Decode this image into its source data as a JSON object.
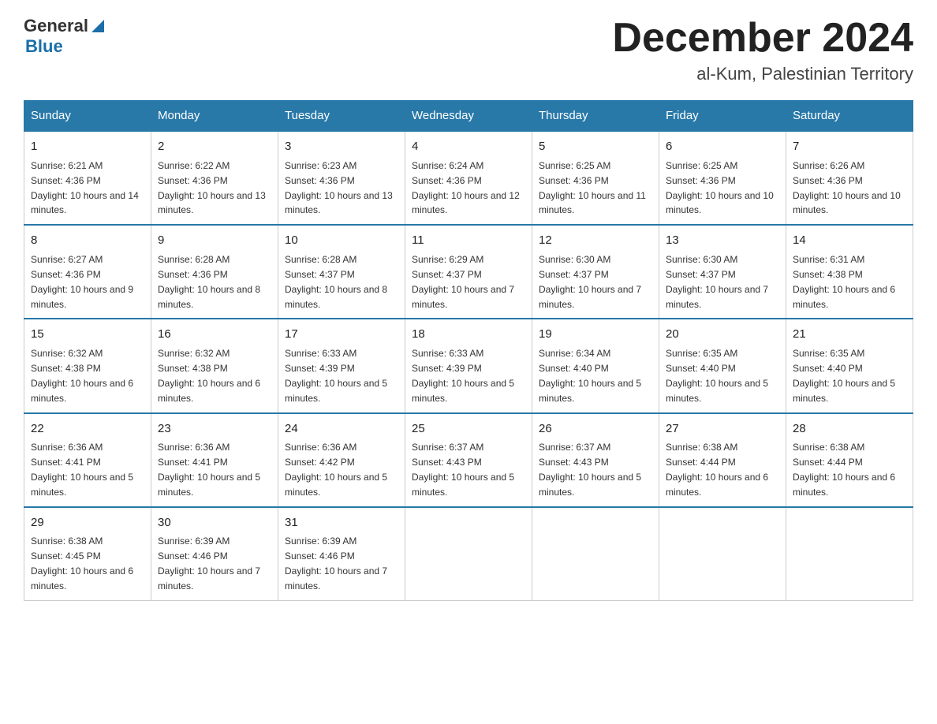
{
  "header": {
    "logo": {
      "text_general": "General",
      "text_blue": "Blue",
      "icon": "▶"
    },
    "title": "December 2024",
    "subtitle": "al-Kum, Palestinian Territory"
  },
  "calendar": {
    "days_of_week": [
      "Sunday",
      "Monday",
      "Tuesday",
      "Wednesday",
      "Thursday",
      "Friday",
      "Saturday"
    ],
    "weeks": [
      [
        {
          "day": "1",
          "sunrise": "6:21 AM",
          "sunset": "4:36 PM",
          "daylight": "10 hours and 14 minutes."
        },
        {
          "day": "2",
          "sunrise": "6:22 AM",
          "sunset": "4:36 PM",
          "daylight": "10 hours and 13 minutes."
        },
        {
          "day": "3",
          "sunrise": "6:23 AM",
          "sunset": "4:36 PM",
          "daylight": "10 hours and 13 minutes."
        },
        {
          "day": "4",
          "sunrise": "6:24 AM",
          "sunset": "4:36 PM",
          "daylight": "10 hours and 12 minutes."
        },
        {
          "day": "5",
          "sunrise": "6:25 AM",
          "sunset": "4:36 PM",
          "daylight": "10 hours and 11 minutes."
        },
        {
          "day": "6",
          "sunrise": "6:25 AM",
          "sunset": "4:36 PM",
          "daylight": "10 hours and 10 minutes."
        },
        {
          "day": "7",
          "sunrise": "6:26 AM",
          "sunset": "4:36 PM",
          "daylight": "10 hours and 10 minutes."
        }
      ],
      [
        {
          "day": "8",
          "sunrise": "6:27 AM",
          "sunset": "4:36 PM",
          "daylight": "10 hours and 9 minutes."
        },
        {
          "day": "9",
          "sunrise": "6:28 AM",
          "sunset": "4:36 PM",
          "daylight": "10 hours and 8 minutes."
        },
        {
          "day": "10",
          "sunrise": "6:28 AM",
          "sunset": "4:37 PM",
          "daylight": "10 hours and 8 minutes."
        },
        {
          "day": "11",
          "sunrise": "6:29 AM",
          "sunset": "4:37 PM",
          "daylight": "10 hours and 7 minutes."
        },
        {
          "day": "12",
          "sunrise": "6:30 AM",
          "sunset": "4:37 PM",
          "daylight": "10 hours and 7 minutes."
        },
        {
          "day": "13",
          "sunrise": "6:30 AM",
          "sunset": "4:37 PM",
          "daylight": "10 hours and 7 minutes."
        },
        {
          "day": "14",
          "sunrise": "6:31 AM",
          "sunset": "4:38 PM",
          "daylight": "10 hours and 6 minutes."
        }
      ],
      [
        {
          "day": "15",
          "sunrise": "6:32 AM",
          "sunset": "4:38 PM",
          "daylight": "10 hours and 6 minutes."
        },
        {
          "day": "16",
          "sunrise": "6:32 AM",
          "sunset": "4:38 PM",
          "daylight": "10 hours and 6 minutes."
        },
        {
          "day": "17",
          "sunrise": "6:33 AM",
          "sunset": "4:39 PM",
          "daylight": "10 hours and 5 minutes."
        },
        {
          "day": "18",
          "sunrise": "6:33 AM",
          "sunset": "4:39 PM",
          "daylight": "10 hours and 5 minutes."
        },
        {
          "day": "19",
          "sunrise": "6:34 AM",
          "sunset": "4:40 PM",
          "daylight": "10 hours and 5 minutes."
        },
        {
          "day": "20",
          "sunrise": "6:35 AM",
          "sunset": "4:40 PM",
          "daylight": "10 hours and 5 minutes."
        },
        {
          "day": "21",
          "sunrise": "6:35 AM",
          "sunset": "4:40 PM",
          "daylight": "10 hours and 5 minutes."
        }
      ],
      [
        {
          "day": "22",
          "sunrise": "6:36 AM",
          "sunset": "4:41 PM",
          "daylight": "10 hours and 5 minutes."
        },
        {
          "day": "23",
          "sunrise": "6:36 AM",
          "sunset": "4:41 PM",
          "daylight": "10 hours and 5 minutes."
        },
        {
          "day": "24",
          "sunrise": "6:36 AM",
          "sunset": "4:42 PM",
          "daylight": "10 hours and 5 minutes."
        },
        {
          "day": "25",
          "sunrise": "6:37 AM",
          "sunset": "4:43 PM",
          "daylight": "10 hours and 5 minutes."
        },
        {
          "day": "26",
          "sunrise": "6:37 AM",
          "sunset": "4:43 PM",
          "daylight": "10 hours and 5 minutes."
        },
        {
          "day": "27",
          "sunrise": "6:38 AM",
          "sunset": "4:44 PM",
          "daylight": "10 hours and 6 minutes."
        },
        {
          "day": "28",
          "sunrise": "6:38 AM",
          "sunset": "4:44 PM",
          "daylight": "10 hours and 6 minutes."
        }
      ],
      [
        {
          "day": "29",
          "sunrise": "6:38 AM",
          "sunset": "4:45 PM",
          "daylight": "10 hours and 6 minutes."
        },
        {
          "day": "30",
          "sunrise": "6:39 AM",
          "sunset": "4:46 PM",
          "daylight": "10 hours and 7 minutes."
        },
        {
          "day": "31",
          "sunrise": "6:39 AM",
          "sunset": "4:46 PM",
          "daylight": "10 hours and 7 minutes."
        },
        null,
        null,
        null,
        null
      ]
    ]
  }
}
